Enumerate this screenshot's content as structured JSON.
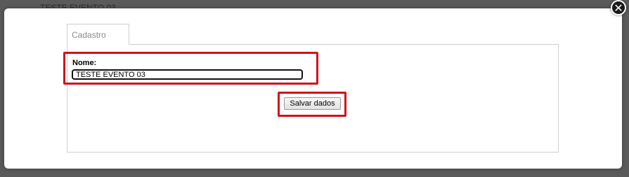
{
  "background": {
    "partial_text": "TESTE EVENTO 03"
  },
  "modal": {
    "close_glyph": "✕",
    "tabs": [
      {
        "label": "Cadastro",
        "active": true
      }
    ],
    "form": {
      "name_label": "Nome:",
      "name_value": "TESTE EVENTO 03",
      "save_label": "Salvar dados"
    }
  },
  "colors": {
    "overlay": "#5a5a5a",
    "highlight": "#d0121b",
    "close_button": "#1a1a1a"
  },
  "icons": {
    "close": "close-icon"
  }
}
